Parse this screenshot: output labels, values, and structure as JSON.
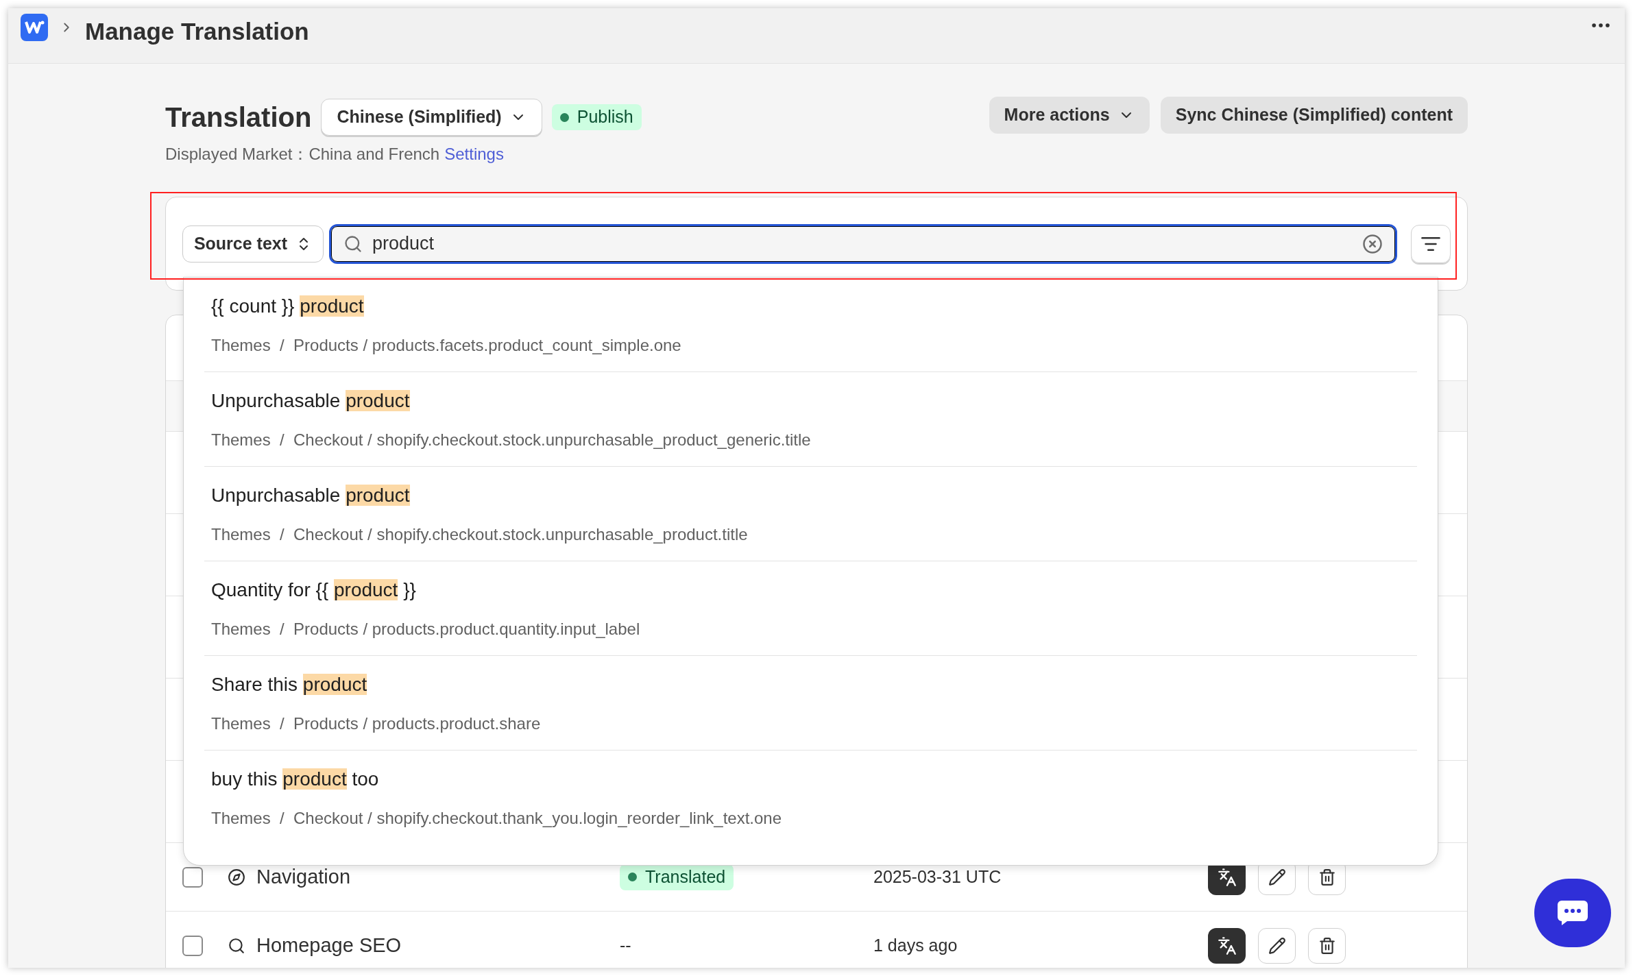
{
  "header": {
    "title": "Manage Translation"
  },
  "page": {
    "title": "Translation",
    "language": "Chinese (Simplified)",
    "status": {
      "label": "Publish",
      "kind": "published"
    },
    "market_label": "Displayed Market：",
    "market_value": "China and French",
    "settings_link": "Settings",
    "actions": [
      {
        "label": "More actions",
        "has_menu": true
      },
      {
        "label": "Sync Chinese (Simplified) content",
        "has_menu": false
      }
    ]
  },
  "search": {
    "scope": "Source text",
    "value": "product"
  },
  "suggestions": [
    {
      "parts": [
        {
          "text": "{{ count }} ",
          "highlight": false
        },
        {
          "text": "product",
          "highlight": true
        }
      ],
      "path": "Themes  /  Products / products.facets.product_count_simple.one"
    },
    {
      "parts": [
        {
          "text": "Unpurchasable ",
          "highlight": false
        },
        {
          "text": "product",
          "highlight": true
        }
      ],
      "path": "Themes  /  Checkout / shopify.checkout.stock.unpurchasable_product_generic.title"
    },
    {
      "parts": [
        {
          "text": "Unpurchasable ",
          "highlight": false
        },
        {
          "text": "product",
          "highlight": true
        }
      ],
      "path": "Themes  /  Checkout / shopify.checkout.stock.unpurchasable_product.title"
    },
    {
      "parts": [
        {
          "text": "Quantity for {{ ",
          "highlight": false
        },
        {
          "text": "product",
          "highlight": true
        },
        {
          "text": " }}",
          "highlight": false
        }
      ],
      "path": "Themes  /  Products / products.product.quantity.input_label"
    },
    {
      "parts": [
        {
          "text": "Share this ",
          "highlight": false
        },
        {
          "text": "product",
          "highlight": true
        }
      ],
      "path": "Themes  /  Products / products.product.share"
    },
    {
      "parts": [
        {
          "text": "buy this ",
          "highlight": false
        },
        {
          "text": "product",
          "highlight": true
        },
        {
          "text": " too",
          "highlight": false
        }
      ],
      "path": "Themes  /  Checkout / shopify.checkout.thank_you.login_reorder_link_text.one"
    }
  ],
  "rows": [
    {
      "name": "Navigation",
      "checked": false,
      "status": {
        "kind": "badge",
        "label": "Translated"
      },
      "date": "2025-03-31 UTC"
    },
    {
      "name": "Homepage SEO",
      "checked": false,
      "status": {
        "kind": "plain",
        "label": "--"
      },
      "date": "1 days ago"
    }
  ]
}
